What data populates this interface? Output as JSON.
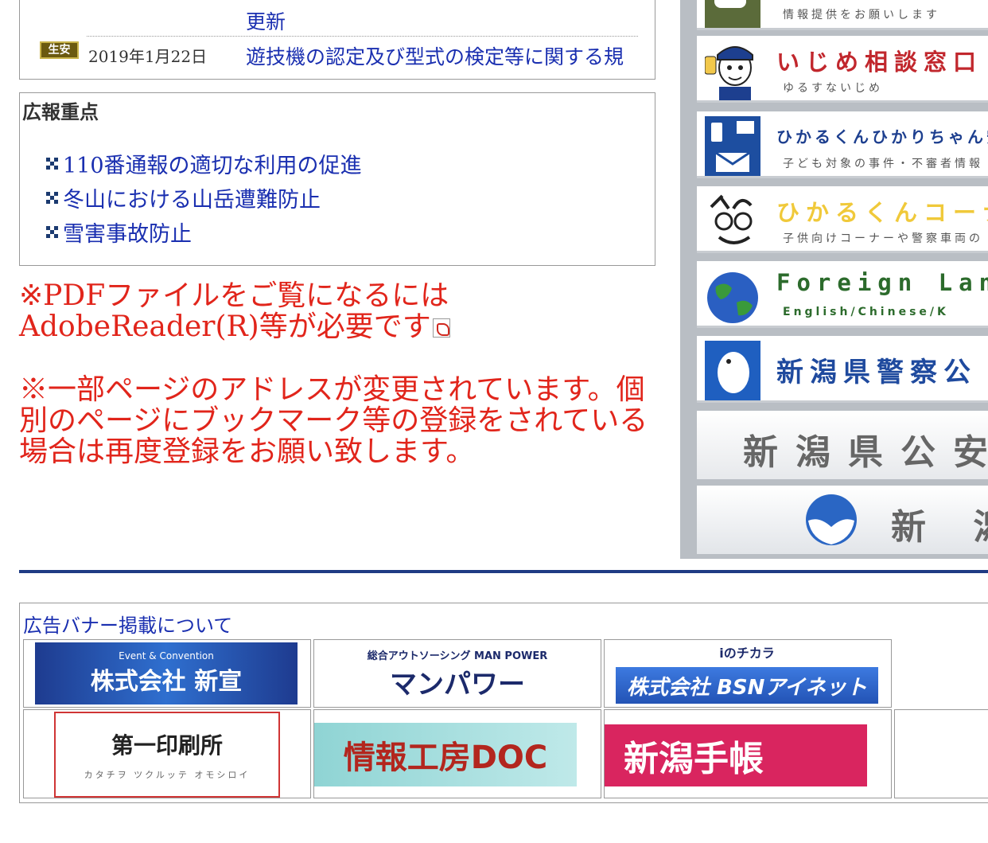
{
  "news": {
    "row1_link": "更新",
    "row2": {
      "badge": "生安",
      "date": "2019年1月22日",
      "link": "遊技機の認定及び型式の検定等に関する規"
    }
  },
  "kouhou": {
    "title": "広報重点",
    "items": [
      {
        "label": "110番通報の適切な利用の促進"
      },
      {
        "label": "冬山における山岳遭難防止"
      },
      {
        "label": "雪害事故防止"
      }
    ]
  },
  "notices": {
    "pdf": "※PDFファイルをご覧になるには AdobeReader(R)等が必要です",
    "address": "※一部ページのアドレスが変更されています。個別のページにブックマーク等の登録をされている場合は再度登録をお願い致します。"
  },
  "side_banners": [
    {
      "title": "",
      "subtitle": "情報提供をお願いします",
      "icon": "chat-icon"
    },
    {
      "title": "いじめ相談窓口",
      "subtitle": "ゆるすないじめ",
      "icon": "police-officer-icon"
    },
    {
      "title": "ひかるくんひかりちゃん安心",
      "subtitle": "子ども対象の事件・不審者情報",
      "icon": "mail-phone-icon"
    },
    {
      "title": "ひかるくんコーナ",
      "subtitle": "子供向けコーナーや警察車両の",
      "icon": "mascot-icon"
    },
    {
      "title": "Foreign Lan",
      "subtitle": "English/Chinese/K",
      "icon": "globe-icon"
    },
    {
      "title": "新潟県警察公",
      "subtitle": "",
      "icon": "mascot-bird-icon"
    },
    {
      "title": "新潟県公安",
      "subtitle": "",
      "icon": ""
    },
    {
      "title": "新 潟",
      "subtitle": "",
      "icon": "emblem-icon"
    }
  ],
  "ads": {
    "heading": "広告バナー掲載について",
    "items": [
      {
        "name": "株式会社 新宣",
        "small": "Event & Convention"
      },
      {
        "name": "マンパワー",
        "small": "総合アウトソーシング MAN POWER"
      },
      {
        "name": "株式会社 BSNアイネット",
        "small": "iのチカラ"
      },
      {
        "name": "第一印刷所",
        "small": "カタチヲ ツクルッテ オモシロイ"
      },
      {
        "name": "情報工房DOC",
        "small": ""
      },
      {
        "name": "新潟手帳",
        "small": ""
      }
    ]
  },
  "colors": {
    "link": "#1a2fb0",
    "notice_red": "#e1251b",
    "divider": "#1f3b84"
  }
}
